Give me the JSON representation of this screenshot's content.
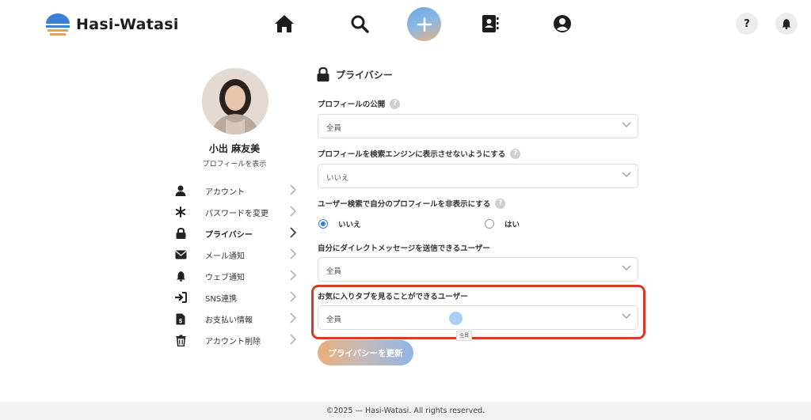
{
  "brand": {
    "name": "Hasi-Watasi"
  },
  "nav": {
    "icons": [
      "home-icon",
      "search-icon",
      "plus-icon",
      "contacts-icon",
      "user-circle-icon"
    ],
    "help_label": "?",
    "bell_icon": "bell-icon"
  },
  "profile": {
    "name": "小出 麻友美",
    "view_link": "プロフィールを表示"
  },
  "menu": {
    "items": [
      {
        "label": "アカウント",
        "icon": "user-icon"
      },
      {
        "label": "パスワードを変更",
        "icon": "asterisk-icon"
      },
      {
        "label": "プライバシー",
        "icon": "lock-icon",
        "active": true
      },
      {
        "label": "メール通知",
        "icon": "envelope-icon"
      },
      {
        "label": "ウェブ通知",
        "icon": "bell-icon"
      },
      {
        "label": "SNS連携",
        "icon": "sign-in-icon"
      },
      {
        "label": "お支払い情報",
        "icon": "invoice-icon"
      },
      {
        "label": "アカウント削除",
        "icon": "trash-icon"
      }
    ]
  },
  "privacy": {
    "title": "プライバシー",
    "fields": [
      {
        "label": "プロフィールの公開",
        "value": "全員"
      },
      {
        "label": "プロフィールを検索エンジンに表示させないようにする",
        "value": "いいえ"
      },
      {
        "label": "ユーザー検索で自分のプロフィールを非表示にする",
        "options": [
          "いいえ",
          "はい"
        ],
        "selected": "いいえ"
      },
      {
        "label": "自分にダイレクトメッセージを送信できるユーザー",
        "value": "全員"
      },
      {
        "label": "お気に入りタブを見ることができるユーザー",
        "value": "全員"
      }
    ],
    "tooltip": "全員",
    "submit_label": "プライバシーを更新"
  },
  "footer": {
    "text": "©2025 — Hasi-Watasi. All rights reserved."
  },
  "colors": {
    "accent": "#3a7bd5",
    "highlight": "#d73a26",
    "gradient_start": "#e8b07a",
    "gradient_end": "#8fb5e6"
  }
}
